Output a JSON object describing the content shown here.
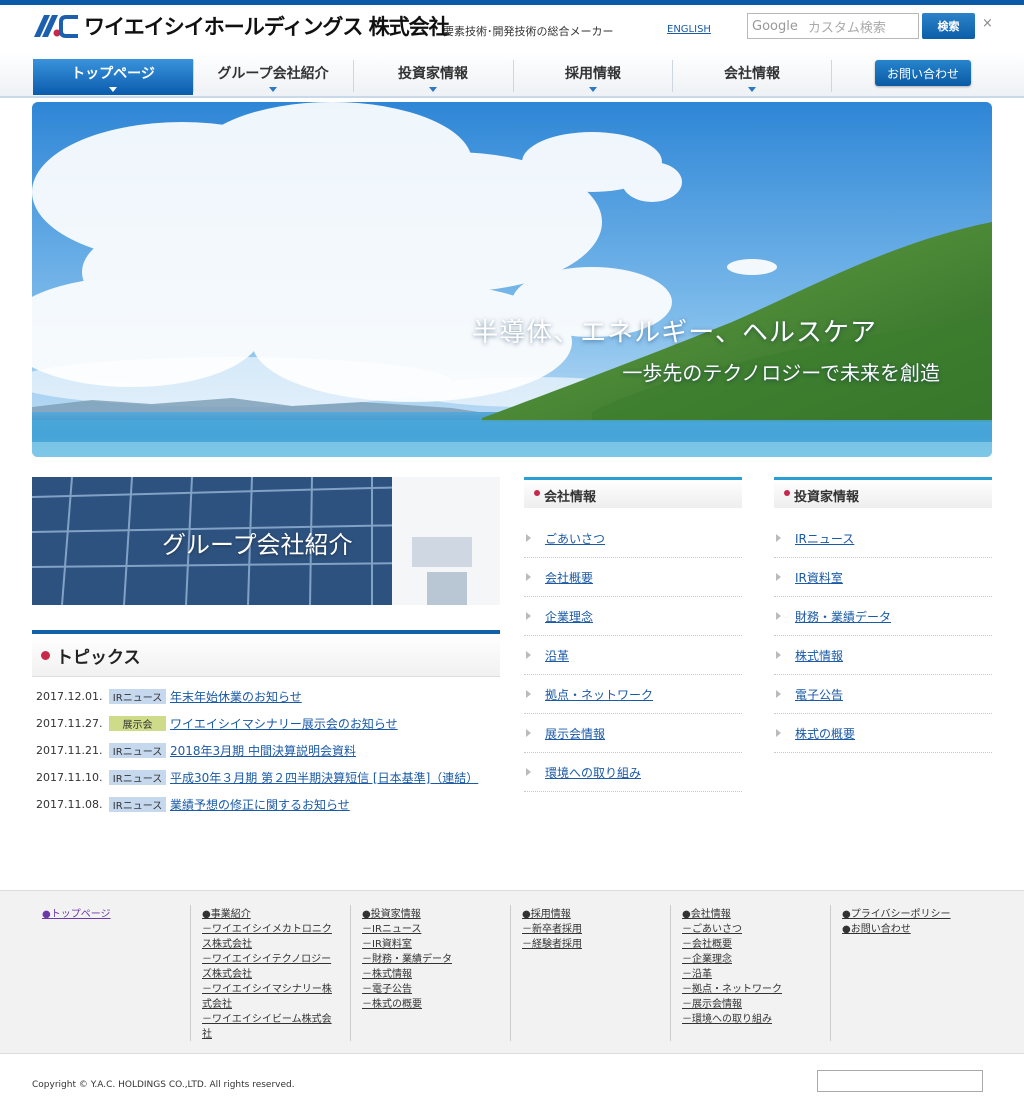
{
  "header": {
    "logo_text": "ワイエイシイホールディングス 株式会社",
    "tagline": "要素技術･開発技術の総合メーカー",
    "english_link": "ENGLISH",
    "search_brand": "Google",
    "search_placeholder": "カスタム検索",
    "search_button": "検索",
    "close": "×"
  },
  "nav": {
    "items": [
      {
        "label": "トップページ"
      },
      {
        "label": "グループ会社紹介"
      },
      {
        "label": "投資家情報"
      },
      {
        "label": "採用情報"
      },
      {
        "label": "会社情報"
      }
    ],
    "contact_button": "お問い合わせ"
  },
  "hero": {
    "headline": "半導体、エネルギー、ヘルスケア",
    "subline": "一歩先のテクノロジーで未来を創造"
  },
  "group_banner": {
    "label": "グループ会社紹介"
  },
  "topics": {
    "title": "トピックス",
    "items": [
      {
        "date": "2017.12.01.",
        "tag": "IRニュース",
        "text": "年末年始休業のお知らせ"
      },
      {
        "date": "2017.11.27.",
        "tag": "展示会",
        "text": "ワイエイシイマシナリー展示会のお知らせ"
      },
      {
        "date": "2017.11.21.",
        "tag": "IRニュース",
        "text": "2018年3月期 中間決算説明会資料"
      },
      {
        "date": "2017.11.10.",
        "tag": "IRニュース",
        "text": "平成30年３月期 第２四半期決算短信 [日本基準]（連結）"
      },
      {
        "date": "2017.11.08.",
        "tag": "IRニュース",
        "text": "業績予想の修正に関するお知らせ"
      }
    ]
  },
  "company_info": {
    "title": "会社情報",
    "items": [
      "ごあいさつ",
      "会社概要",
      "企業理念",
      "沿革",
      "拠点・ネットワーク",
      "展示会情報",
      "環境への取り組み"
    ]
  },
  "investor_info": {
    "title": "投資家情報",
    "items": [
      "IRニュース",
      "IR資料室",
      "財務・業績データ",
      "株式情報",
      "電子公告",
      "株式の概要"
    ]
  },
  "footer": {
    "col1": [
      "●トップページ"
    ],
    "col2": [
      "●事業紹介",
      "－ワイエイシイメカトロニクス株式会社",
      "－ワイエイシイテクノロジーズ株式会社",
      "－ワイエイシイマシナリー株式会社",
      "－ワイエイシイビーム株式会社"
    ],
    "col3": [
      "●投資家情報",
      "－IRニュース",
      "－IR資料室",
      "－財務・業績データ",
      "－株式情報",
      "－電子公告",
      "－株式の概要"
    ],
    "col4": [
      "●採用情報",
      "－新卒者採用",
      "－経験者採用"
    ],
    "col5": [
      "●会社情報",
      "－ごあいさつ",
      "－会社概要",
      "－企業理念",
      "－沿革",
      "－拠点・ネットワーク",
      "－展示会情報",
      "－環境への取り組み"
    ],
    "col6": [
      "●プライバシーポリシー",
      "●お問い合わせ"
    ],
    "copyright": "Copyright © Y.A.C. HOLDINGS CO.,LTD. All rights reserved."
  },
  "colors": {
    "brand_blue": "#0a5aa8",
    "accent_red": "#c8284a",
    "ir_tag": "#c6d8ee",
    "expo_tag": "#cedc8a"
  }
}
